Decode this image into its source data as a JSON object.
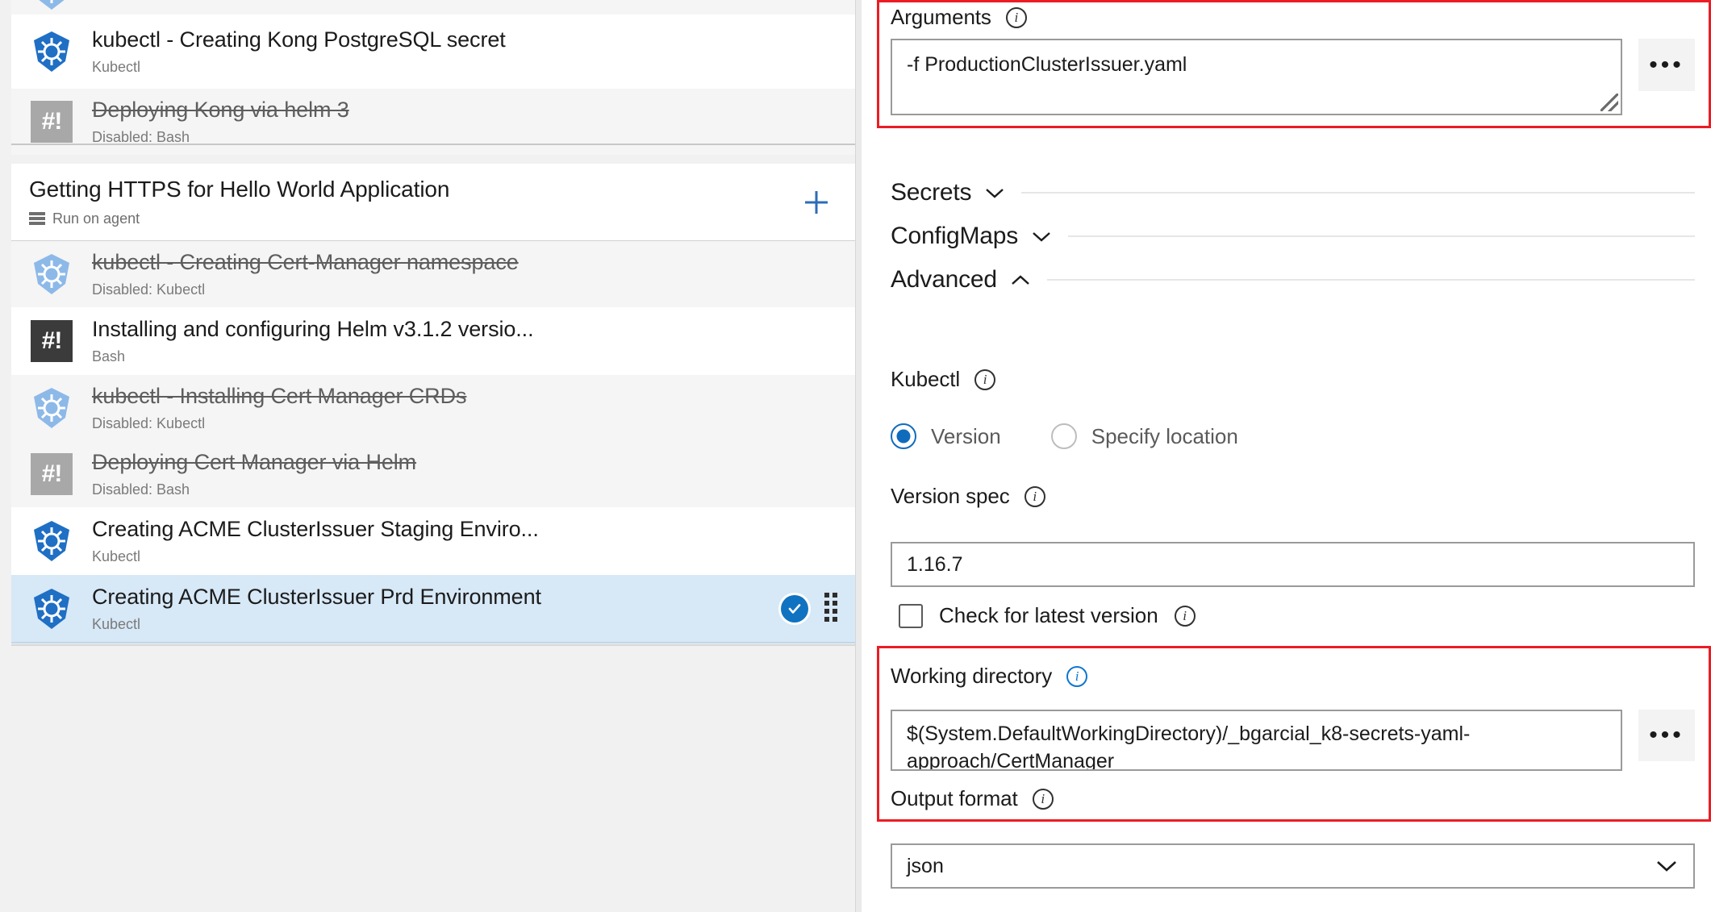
{
  "left_panel": {
    "partial_row_top": {
      "icon": "kubernetes-icon-disabled"
    },
    "groups": [
      {
        "type": "tasks",
        "tasks": [
          {
            "title": "kubectl - Creating Kong PostgreSQL secret",
            "subtitle": "Kubectl",
            "icon": "kubernetes-icon",
            "disabled": false,
            "shaded": false
          },
          {
            "title": "Deploying Kong via helm 3",
            "subtitle": "Disabled: Bash",
            "icon": "bash-icon",
            "disabled": true,
            "shaded": true
          }
        ]
      },
      {
        "type": "phase",
        "header": {
          "title": "Getting HTTPS for Hello World Application",
          "subtitle": "Run on agent",
          "agent_icon": "server-icon",
          "add_label": "+"
        },
        "tasks": [
          {
            "title": "kubectl - Creating Cert-Manager namespace",
            "subtitle": "Disabled: Kubectl",
            "icon": "kubernetes-icon",
            "disabled": true,
            "shaded": true
          },
          {
            "title": "Installing and configuring Helm v3.1.2 versio...",
            "subtitle": "Bash",
            "icon": "bash-icon",
            "disabled": false,
            "shaded": false
          },
          {
            "title": "kubectl - Installing Cert Manager CRDs",
            "subtitle": "Disabled: Kubectl",
            "icon": "kubernetes-icon",
            "disabled": true,
            "shaded": true
          },
          {
            "title": "Deploying Cert Manager via Helm",
            "subtitle": "Disabled: Bash",
            "icon": "bash-icon",
            "disabled": true,
            "shaded": true
          },
          {
            "title": "Creating ACME ClusterIssuer Staging Enviro...",
            "subtitle": "Kubectl",
            "icon": "kubernetes-icon",
            "disabled": false,
            "shaded": false
          },
          {
            "title": "Creating ACME ClusterIssuer Prd Environment",
            "subtitle": "Kubectl",
            "icon": "kubernetes-icon",
            "disabled": false,
            "shaded": false,
            "selected": true,
            "status_icon": "check-circle-icon",
            "drag_handle": "drag-dots-icon"
          }
        ]
      }
    ]
  },
  "right_panel": {
    "arguments": {
      "label": "Arguments",
      "info": "i",
      "value": "-f ProductionClusterIssuer.yaml",
      "browse_label": "•••"
    },
    "sections": [
      {
        "name": "Secrets",
        "expanded": false,
        "chevron": "chevron-down-icon"
      },
      {
        "name": "ConfigMaps",
        "expanded": false,
        "chevron": "chevron-down-icon"
      },
      {
        "name": "Advanced",
        "expanded": true,
        "chevron": "chevron-up-icon"
      }
    ],
    "kubectl": {
      "label": "Kubectl",
      "info": "i",
      "options": [
        {
          "label": "Version",
          "selected": true
        },
        {
          "label": "Specify location",
          "selected": false
        }
      ]
    },
    "version_spec": {
      "label": "Version spec",
      "info": "i",
      "value": "1.16.7"
    },
    "check_latest": {
      "label": "Check for latest version",
      "info": "i",
      "checked": false
    },
    "working_directory": {
      "label": "Working directory",
      "info": "i",
      "info_state": "blue",
      "value": "$(System.DefaultWorkingDirectory)/_bgarcial_k8-secrets-yaml-approach/CertManager",
      "browse_label": "•••"
    },
    "output_format": {
      "label": "Output format",
      "info": "i",
      "value": "json",
      "chevron": "chevron-down-icon"
    },
    "highlight_color": "#ec1c24"
  }
}
